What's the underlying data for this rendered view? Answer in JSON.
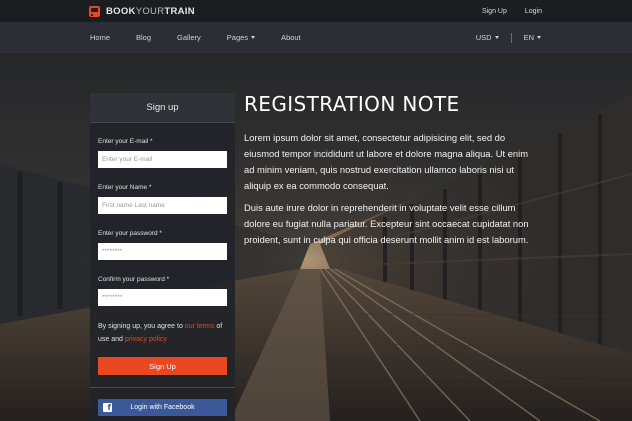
{
  "brand": {
    "name_bold_1": "BOOK",
    "name_light": "YOUR",
    "name_bold_2": "TRAIN"
  },
  "top_links": {
    "sign_up": "Sign Up",
    "login": "Login"
  },
  "nav": {
    "items": [
      {
        "label": "Home"
      },
      {
        "label": "Blog"
      },
      {
        "label": "Gallery"
      },
      {
        "label": "Pages"
      },
      {
        "label": "About"
      }
    ],
    "currency": "USD",
    "language": "EN"
  },
  "signup": {
    "title": "Sign up",
    "email_label": "Enter your E-mail *",
    "email_placeholder": "Enter your E-mail",
    "name_label": "Enter your Name *",
    "name_placeholder": "First name Last name",
    "password_label": "Enter your password *",
    "password_value": "********",
    "confirm_label": "Confirm your password *",
    "confirm_value": "********",
    "terms_prefix": "By signing up, you agree to",
    "terms_link": "our terms",
    "terms_mid": "of use and",
    "privacy_link": "privacy policy",
    "submit_label": "Sign Up",
    "facebook_label": "Login with Facebook"
  },
  "note": {
    "title": "REGISTRATION NOTE",
    "paragraph_1": "Lorem ipsum dolor sit amet, consectetur adipisicing elit, sed do eiusmod tempor incididunt ut labore et dolore magna aliqua. Ut enim ad minim veniam, quis nostrud exercitation ullamco laboris nisi ut aliquip ex ea commodo consequat.",
    "paragraph_2": "Duis aute irure dolor in reprehenderit in voluptate velit esse cillum dolore eu fugiat nulla pariatur. Excepteur sint occaecat cupidatat non proident, sunt in culpa qui officia deserunt mollit anim id est laborum."
  },
  "colors": {
    "accent": "#e8471f",
    "facebook": "#3b5998",
    "topbar": "#1b1d21",
    "navbar": "#2b2e34"
  },
  "icons": {
    "logo": "train-icon",
    "facebook": "facebook-icon",
    "dropdown": "chevron-down-icon"
  }
}
